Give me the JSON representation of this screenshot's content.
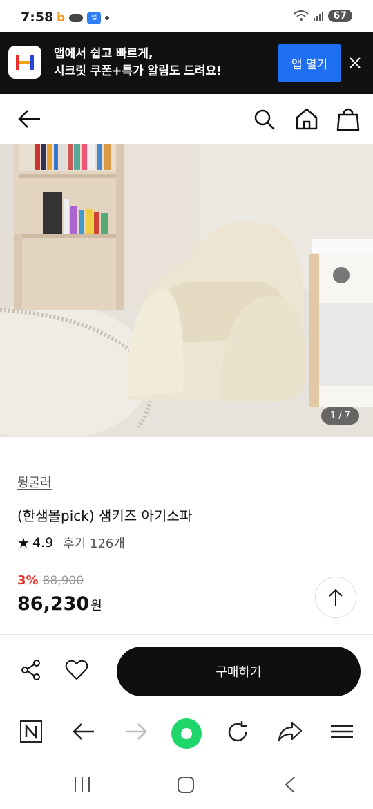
{
  "status_bar": {
    "time": "7:58",
    "battery": "67"
  },
  "app_banner": {
    "line1": "앱에서 쉽고 빠르게,",
    "line2": "시크릿 쿠폰+특가 알림도 드려요!",
    "open_label": "앱 열기"
  },
  "product": {
    "image_counter": "1 / 7",
    "brand": "뒹굴러",
    "title": "(한샘몰pick) 샘키즈 아기소파",
    "rating": "4.9",
    "reviews": "후기 126개",
    "discount": "3%",
    "original_price": "88,900",
    "price": "86,230",
    "currency": "원"
  },
  "purchase_bar": {
    "buy_label": "구매하기"
  },
  "colors": {
    "banner_bg": "#111111",
    "open_button": "#1e6ff1",
    "discount": "#e5312b",
    "buy_button": "#0f0f0f",
    "browser_green": "#1fd66a"
  }
}
